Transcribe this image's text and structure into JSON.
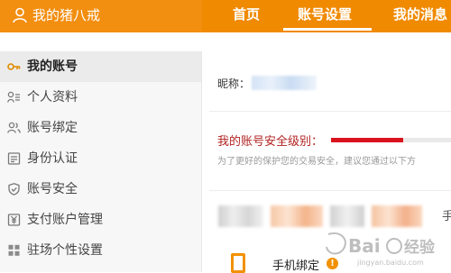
{
  "header": {
    "user_name": "我的猪八戒",
    "nav": [
      {
        "label": "首页"
      },
      {
        "label": "账号设置"
      },
      {
        "label": "我的消息"
      }
    ],
    "active_nav_index": 1
  },
  "sidebar": {
    "items": [
      {
        "label": "我的账号",
        "icon": "key-icon"
      },
      {
        "label": "个人资料",
        "icon": "profile-icon"
      },
      {
        "label": "账号绑定",
        "icon": "users-icon"
      },
      {
        "label": "身份认证",
        "icon": "id-card-icon"
      },
      {
        "label": "账号安全",
        "icon": "shield-icon"
      },
      {
        "label": "支付账户管理",
        "icon": "yen-icon"
      },
      {
        "label": "驻场个性设置",
        "icon": "grid-icon"
      }
    ],
    "active_index": 0
  },
  "main": {
    "nickname_label": "昵称：",
    "security_label": "我的账号安全级别：",
    "security_level_fraction": 0.6,
    "security_tip": "为了更好的保护您的交易安全，建议您通过以下方",
    "row_tail": "手",
    "phone_bind_label": "手机绑定",
    "warning_symbol": "!"
  },
  "colors": {
    "topbar": "#f08a00",
    "accent": "#f29100",
    "danger": "#d9131d",
    "security_text": "#b22222"
  },
  "watermark": {
    "text": "Bai 经验",
    "sub": "jingyan.baidu.com"
  }
}
